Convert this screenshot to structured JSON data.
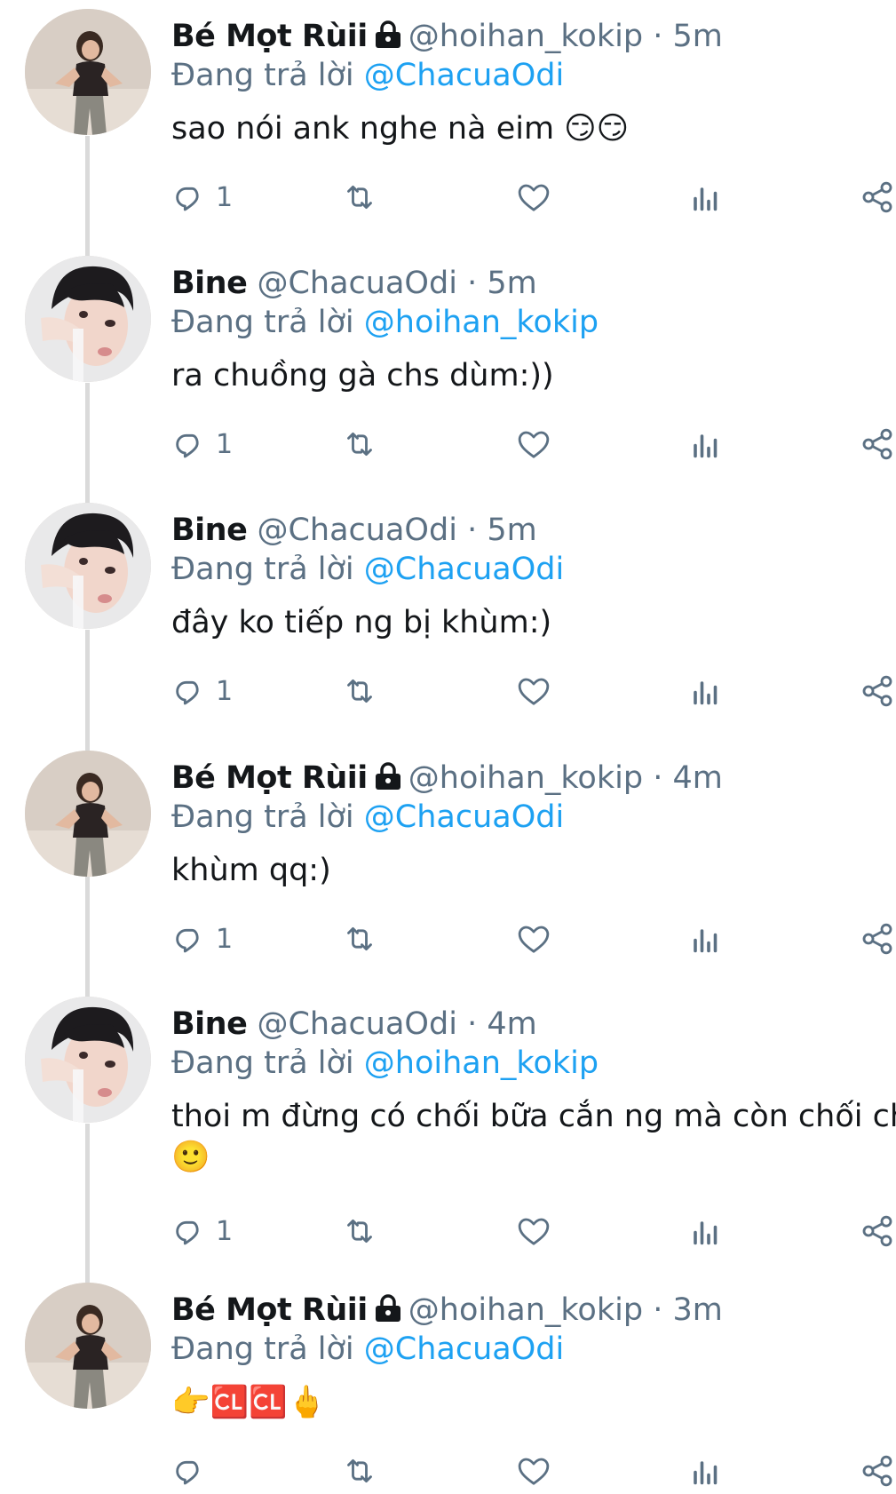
{
  "reply_prefix": "Đang trả lời",
  "colors": {
    "accent": "#1da1f2",
    "muted": "#5b7083",
    "text": "#14171a"
  },
  "tweets": [
    {
      "name": "Bé Mọt Rùii",
      "locked": true,
      "handle": "@hoihan_kokip",
      "sep": "·",
      "time": "5m",
      "reply_to": "@ChacuaOdi",
      "text": "sao nói ank nghe nà eim 😏😏",
      "text2": "",
      "reply_count": "1",
      "avatar": "dancer"
    },
    {
      "name": "Bine",
      "locked": false,
      "handle": "@ChacuaOdi",
      "sep": "·",
      "time": "5m",
      "reply_to": "@hoihan_kokip",
      "text": "ra chuồng gà chs dùm:))",
      "text2": "",
      "reply_count": "1",
      "avatar": "boy"
    },
    {
      "name": "Bine",
      "locked": false,
      "handle": "@ChacuaOdi",
      "sep": "·",
      "time": "5m",
      "reply_to": "@ChacuaOdi",
      "text": "đây ko tiếp ng bị khùm:)",
      "text2": "",
      "reply_count": "1",
      "avatar": "boy"
    },
    {
      "name": "Bé Mọt Rùii",
      "locked": true,
      "handle": "@hoihan_kokip",
      "sep": "·",
      "time": "4m",
      "reply_to": "@ChacuaOdi",
      "text": "khùm qq:)",
      "text2": "",
      "reply_count": "1",
      "avatar": "dancer"
    },
    {
      "name": "Bine",
      "locked": false,
      "handle": "@ChacuaOdi",
      "sep": "·",
      "time": "4m",
      "reply_to": "@hoihan_kokip",
      "text": "thoi m đừng có chối bữa cắn ng mà còn chối chc",
      "text2": "🙂",
      "reply_count": "1",
      "avatar": "boy"
    },
    {
      "name": "Bé Mọt Rùii",
      "locked": true,
      "handle": "@hoihan_kokip",
      "sep": "·",
      "time": "3m",
      "reply_to": "@ChacuaOdi",
      "text": "👉🆑🆑🖕",
      "text2": "",
      "reply_count": "",
      "avatar": "dancer"
    }
  ]
}
